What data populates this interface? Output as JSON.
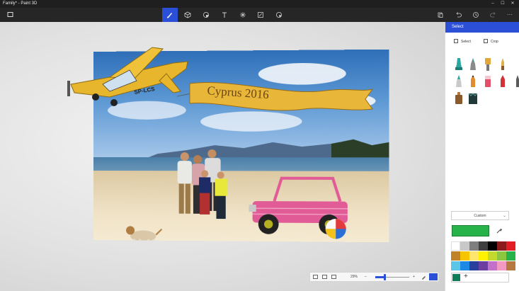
{
  "window": {
    "title": "Family* - Paint 3D",
    "controls": {
      "minimize": "–",
      "maximize": "☐",
      "close": "✕"
    }
  },
  "toolbar": {
    "menu_icon": "menu-icon",
    "tools": [
      {
        "name": "brushes",
        "icon": "brush-icon",
        "active": true
      },
      {
        "name": "3d-shapes",
        "icon": "cube-icon",
        "active": false
      },
      {
        "name": "stickers",
        "icon": "sticker-icon",
        "active": false
      },
      {
        "name": "text",
        "icon": "text-icon",
        "active": false
      },
      {
        "name": "effects",
        "icon": "effects-icon",
        "active": false
      },
      {
        "name": "canvas",
        "icon": "canvas-icon",
        "active": false
      },
      {
        "name": "remix-3d",
        "icon": "remix-icon",
        "active": false
      }
    ],
    "right_actions": [
      {
        "name": "paste",
        "icon": "paste-icon"
      },
      {
        "name": "undo",
        "icon": "undo-icon"
      },
      {
        "name": "history",
        "icon": "history-icon"
      },
      {
        "name": "redo",
        "icon": "redo-icon"
      },
      {
        "name": "more",
        "icon": "more-icon",
        "glyph": "···"
      }
    ],
    "accent_color": "#2b4fd6"
  },
  "canvas": {
    "banner_text": "Cyprus 2016",
    "plane_text": "SP-LCS"
  },
  "panel": {
    "header": "Select",
    "select_label": "Select",
    "crop_label": "Crop",
    "brushes": [
      {
        "name": "marker",
        "color": "#2aa7a1"
      },
      {
        "name": "calligraphy-pen",
        "color": "#6e6e6e"
      },
      {
        "name": "oil-brush",
        "color": "#e2a73b"
      },
      {
        "name": "watercolor",
        "color": "#e0b04c"
      },
      {
        "name": "pixel-pen",
        "color": "#2aa7a1"
      },
      {
        "name": "pencil",
        "color": "#e48c2b"
      },
      {
        "name": "eraser",
        "color": "#e34f68"
      },
      {
        "name": "crayon",
        "color": "#d2313a"
      },
      {
        "name": "spray-can",
        "color": "#5a5a5a"
      },
      {
        "name": "fill",
        "color": "#8b5a2b"
      },
      {
        "name": "fill-2",
        "color": "#203a3a"
      }
    ],
    "thickness_select": "Custom",
    "current_color": "#27b34a",
    "palette": [
      "#ffffff",
      "#c8c8c8",
      "#7f7f7f",
      "#3f3f3f",
      "#000000",
      "#8b1a1a",
      "#e31d25",
      "#c08329",
      "#f7c400",
      "#ffe66d",
      "#fff200",
      "#c4d92e",
      "#8dc63f",
      "#27b34a",
      "#5bc6e8",
      "#1e88e5",
      "#2a3f9d",
      "#6b3fa0",
      "#c270c9",
      "#f39ac3",
      "#b5793f"
    ],
    "custom_color": "#0f7d5a",
    "add_color_label": "+"
  },
  "zoombar": {
    "zoom_label": "29%",
    "zoom_fraction": 0.29,
    "minus": "–",
    "plus": "+"
  }
}
